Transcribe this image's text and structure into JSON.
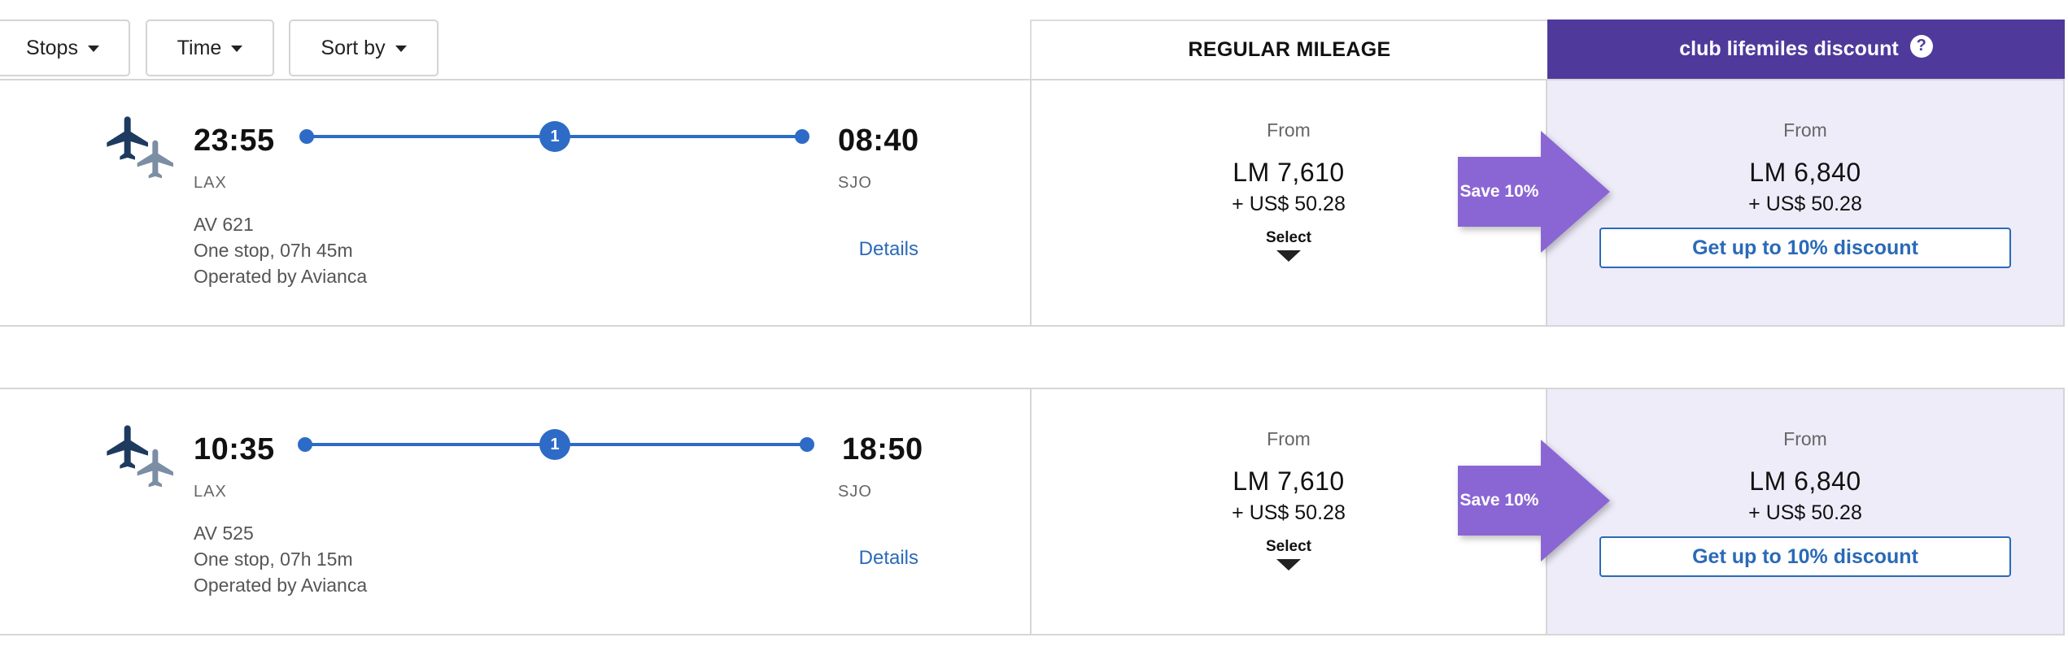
{
  "filters": {
    "stops_label": "Stops",
    "time_label": "Time",
    "sort_label": "Sort by"
  },
  "columns": {
    "regular_label": "REGULAR MILEAGE",
    "club_label": "club lifemiles discount",
    "help_glyph": "?"
  },
  "flights": [
    {
      "departure_time": "23:55",
      "departure_airport": "LAX",
      "arrival_time": "08:40",
      "arrival_airport": "SJO",
      "stops_count": "1",
      "flight_number": "AV 621",
      "duration_text": "One stop, 07h 45m",
      "operator_text": "Operated by Avianca",
      "details_label": "Details",
      "regular": {
        "from_label": "From",
        "miles": "LM 7,610",
        "taxes": "+ US$ 50.28",
        "select_label": "Select"
      },
      "save_label": "Save 10%",
      "club": {
        "from_label": "From",
        "miles": "LM 6,840",
        "taxes": "+ US$ 50.28",
        "button_label": "Get up to 10% discount"
      }
    },
    {
      "departure_time": "10:35",
      "departure_airport": "LAX",
      "arrival_time": "18:50",
      "arrival_airport": "SJO",
      "stops_count": "1",
      "flight_number": "AV 525",
      "duration_text": "One stop, 07h 15m",
      "operator_text": "Operated by Avianca",
      "details_label": "Details",
      "regular": {
        "from_label": "From",
        "miles": "LM 7,610",
        "taxes": "+ US$ 50.28",
        "select_label": "Select"
      },
      "save_label": "Save 10%",
      "club": {
        "from_label": "From",
        "miles": "LM 6,840",
        "taxes": "+ US$ 50.28",
        "button_label": "Get up to 10% discount"
      }
    }
  ],
  "colors": {
    "club_header": "#4f3a9c",
    "club_cell_bg": "#eeecf9",
    "route_line": "#2d6bc6",
    "link": "#2a6ab7",
    "save_arrow": "#8a66d4",
    "plane_primary": "#1e3a5f",
    "plane_secondary": "#7b8ea3"
  }
}
